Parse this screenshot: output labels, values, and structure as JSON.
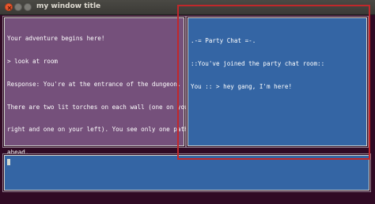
{
  "window": {
    "title": "my window title"
  },
  "story_pane": {
    "lines": [
      "Your adventure begins here!",
      "> look at room",
      "Response: You're at the entrance of the dungeon.",
      "There are two lit torches on each wall (one on your",
      "right and one on your left). You see only one path:",
      "ahead."
    ]
  },
  "chat_pane": {
    "lines": [
      ".-= Party Chat =-.",
      "::You've joined the party chat room::",
      "You :: > hey gang, I'm here!"
    ]
  },
  "input_pane": {
    "value": ""
  },
  "colors": {
    "terminal_bg": "#300a24",
    "story_bg": "#75507b",
    "chat_bg": "#3465a4",
    "input_bg": "#3465a4",
    "highlight_border": "#c0282b"
  }
}
